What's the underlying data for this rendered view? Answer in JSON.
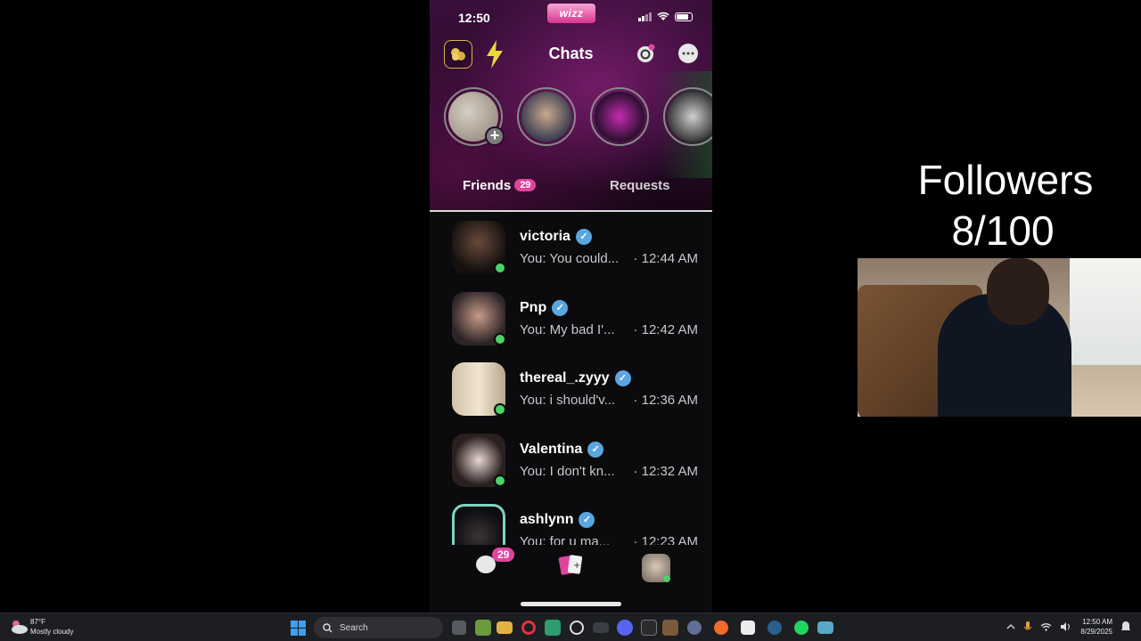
{
  "phone": {
    "status_time": "12:50",
    "app_logo": "wizz",
    "header_title": "Chats",
    "tabs": {
      "friends_label": "Friends",
      "friends_count": "29",
      "requests_label": "Requests"
    },
    "chats": [
      {
        "name": "victoria",
        "preview": "You: You could...",
        "time": "· 12:44 AM",
        "online": true
      },
      {
        "name": "Pnp",
        "preview": "You: My bad I'...",
        "time": "· 12:42 AM",
        "online": true
      },
      {
        "name": "thereal_.zyyy",
        "preview": "You: i should'v...",
        "time": "· 12:36 AM",
        "online": true
      },
      {
        "name": "Valentina",
        "preview": "You: I don't kn...",
        "time": "· 12:32 AM",
        "online": true
      },
      {
        "name": "ashlynn",
        "preview": "You: for u ma...",
        "time": "· 12:23 AM",
        "online": false
      }
    ],
    "bottom_nav": {
      "chat_badge": "29"
    }
  },
  "overlay": {
    "followers_title": "Followers",
    "followers_count": "8/100"
  },
  "taskbar": {
    "weather_temp": "87°F",
    "weather_desc": "Mostly cloudy",
    "search_label": "Search",
    "clock_time": "12:50 AM",
    "clock_date": "8/29/2025"
  },
  "colors": {
    "accent_pink": "#e0459d",
    "online_green": "#4bd36b",
    "verified_blue": "#5aa6e0"
  }
}
